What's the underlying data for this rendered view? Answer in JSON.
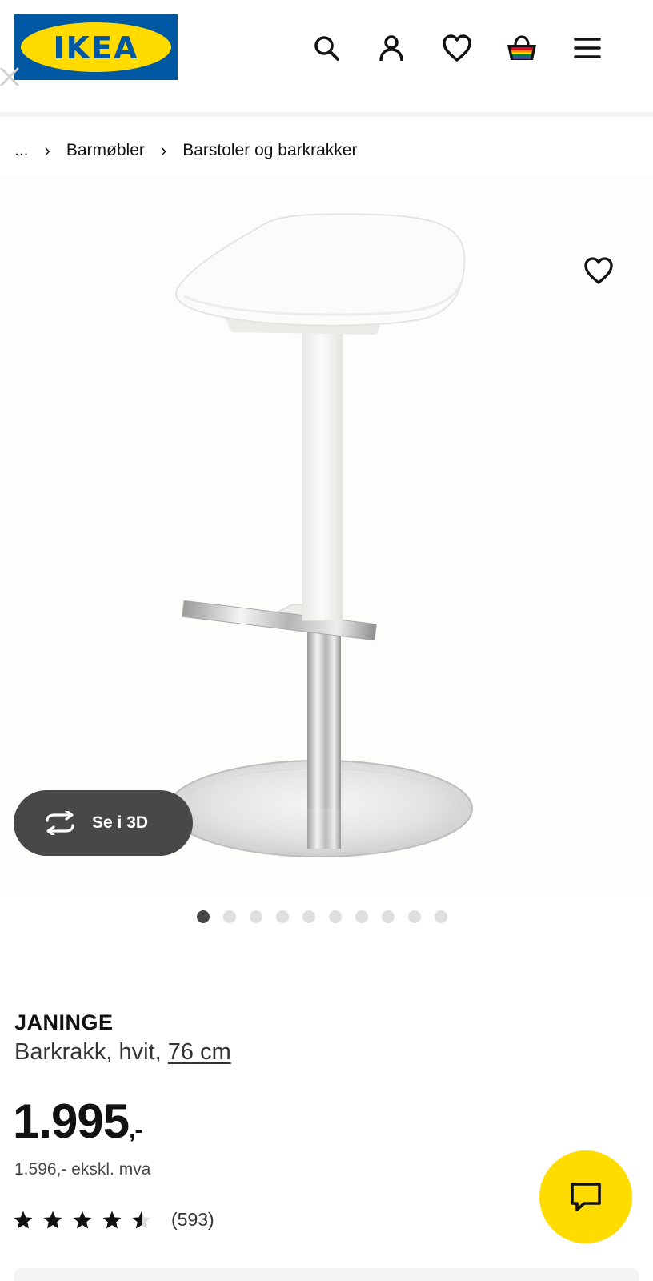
{
  "header": {
    "logo_text": "IKEA",
    "logo_reg": "®",
    "colors": {
      "brand_blue": "#0058a3",
      "brand_yellow": "#ffdb00"
    },
    "icons": [
      "close-icon",
      "search-icon",
      "user-icon",
      "heart-icon",
      "cart-icon",
      "menu-icon"
    ]
  },
  "breadcrumb": {
    "ellipsis": "...",
    "separator": "›",
    "items": [
      "Barmøbler",
      "Barstoler og barkrakker"
    ]
  },
  "gallery": {
    "button_3d_label": "Se i 3D",
    "button_3d_icon": "rotate-arrows-icon",
    "favourite_icon": "heart-icon",
    "image_count": 10,
    "active_index": 0
  },
  "product": {
    "name": "JANINGE",
    "description": "Barkrakk, hvit, ",
    "size": "76 cm",
    "price": "1.995",
    "price_suffix": ",-",
    "price_ex_vat": "1.596,- ekskl. mva",
    "rating": 4.5,
    "rating_max": 5,
    "review_count": "(593)"
  },
  "chat": {
    "icon": "chat-bubble-icon",
    "color": "#ffdb00"
  }
}
